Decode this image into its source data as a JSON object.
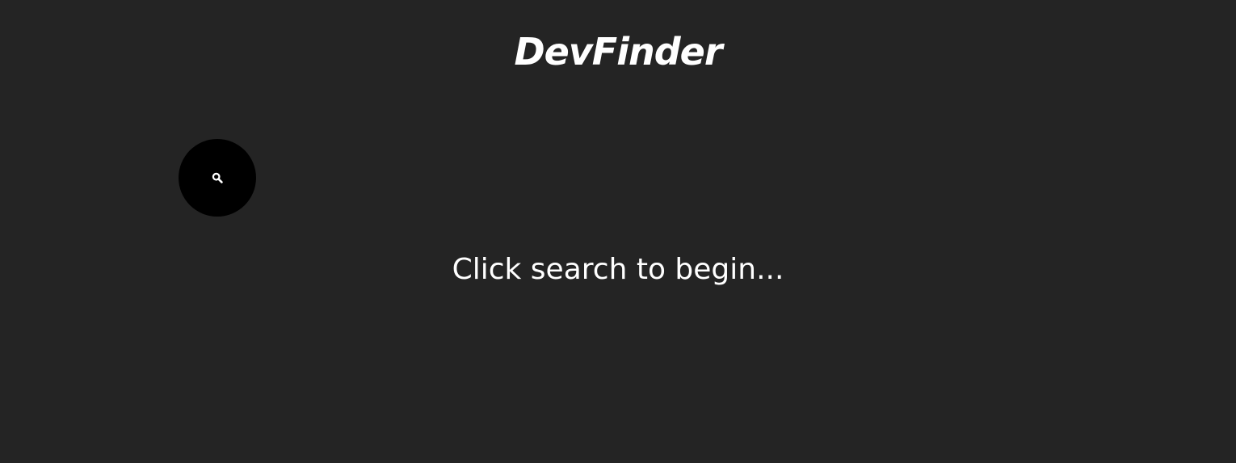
{
  "header": {
    "title": "DevFinder"
  },
  "search": {
    "icon": "search-icon",
    "aria_label": "Search",
    "button_color": "#000000"
  },
  "main": {
    "prompt": "Click search to begin..."
  },
  "theme": {
    "background": "#242424",
    "text": "#ffffff"
  }
}
